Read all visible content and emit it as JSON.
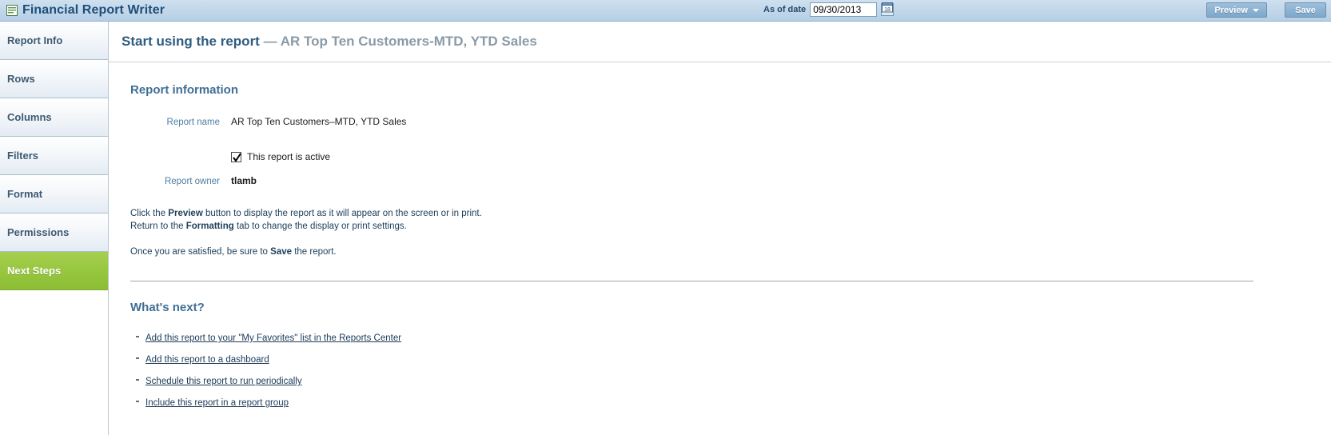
{
  "header": {
    "app_icon": "document-lines-icon",
    "title": "Financial Report Writer",
    "asof_label": "As of date",
    "asof_value": "09/30/2013",
    "asof_placeholder": "MM/DD/YYYY",
    "calendar_icon": "calendar-icon",
    "calendar_icon_label": "18",
    "preview_label": "Preview",
    "preview_caret_icon": "chevron-down-icon",
    "save_label": "Save",
    "accent_blue": "#1f4e79",
    "bar_blue": "#c2d7ea"
  },
  "sidebar": {
    "items": [
      {
        "label": "Report Info",
        "active": false
      },
      {
        "label": "Rows",
        "active": false
      },
      {
        "label": "Columns",
        "active": false
      },
      {
        "label": "Filters",
        "active": false
      },
      {
        "label": "Format",
        "active": false
      },
      {
        "label": "Permissions",
        "active": false
      },
      {
        "label": "Next Steps",
        "active": true
      }
    ],
    "active_green": "#96c63e"
  },
  "page": {
    "title": "Start using the report",
    "title_separator": " — ",
    "title_sub": "AR Top Ten Customers-MTD, YTD Sales"
  },
  "report_information": {
    "section_title": "Report information",
    "report_name_label": "Report name",
    "report_name_value": "AR Top Ten Customers–MTD, YTD Sales",
    "active_checkbox_label": "This report is active",
    "active_checkbox_checked": true,
    "checkmark_icon": "check-icon",
    "report_owner_label": "Report owner",
    "report_owner_value": "tlamb",
    "instruction_line1_a": "Click the ",
    "instruction_line1_b": "Preview",
    "instruction_line1_c": " button to display the report as it will appear on the screen or in print.",
    "instruction_line2_a": "Return to the ",
    "instruction_line2_b": "Formatting",
    "instruction_line2_c": " tab to change the display or print settings.",
    "instruction_line3_a": "Once you are satisfied, be sure to ",
    "instruction_line3_b": "Save",
    "instruction_line3_c": " the report."
  },
  "whats_next": {
    "section_title": "What's next?",
    "links": [
      "Add this report to your \"My Favorites\" list in the Reports Center",
      "Add this report to a dashboard",
      "Schedule this report to run periodically",
      "Include this report in a report group"
    ]
  }
}
